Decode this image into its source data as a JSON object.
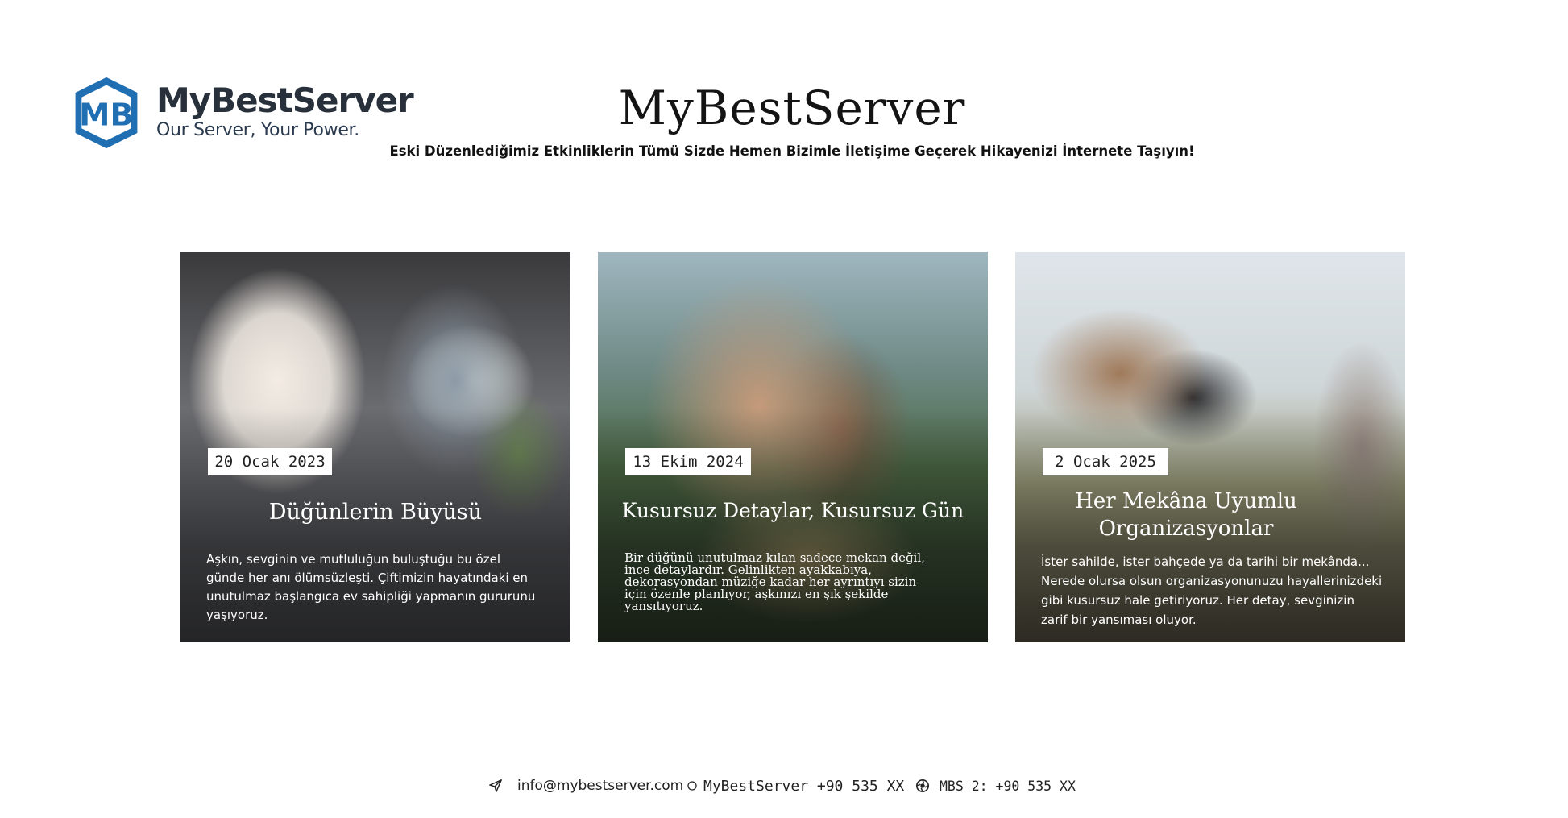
{
  "brand": {
    "logo_name": "MyBestServer",
    "logo_tagline": "Our Server, Your Power.",
    "logo_monogram": "MB",
    "brand_color": "#1f6fb2"
  },
  "header": {
    "title": "MyBestServer",
    "tagline": "Eski Düzenlediğimiz Etkinliklerin Tümü Sizde Hemen Bizimle İletişime Geçerek Hikayenizi İnternete Taşıyın!"
  },
  "cards": [
    {
      "date": "20 Ocak 2023",
      "title": "Düğünlerin Büyüsü",
      "description": "Aşkın, sevginin ve mutluluğun buluştuğu bu özel günde her anı ölümsüzleşti. Çiftimizin hayatındaki en unutulmaz başlangıca ev sahipliği yapmanın gururunu yaşıyoruz."
    },
    {
      "date": "13 Ekim 2024",
      "title": "Kusursuz Detaylar, Kusursuz Gün",
      "description": "Bir düğünü unutulmaz kılan sadece mekan değil, ince detaylardır. Gelinlikten ayakkabıya, dekorasyondan müziğe kadar her ayrıntıyı sizin için özenle planlıyor, aşkınızı en şık şekilde yansıtıyoruz."
    },
    {
      "date": "2 Ocak 2025",
      "title": "Her Mekâna Uyumlu Organizasyonlar",
      "description": "İster sahilde, ister bahçede ya da tarihi bir mekânda... Nerede olursa olsun organizasyonunuzu hayallerinizdeki gibi kusursuz hale getiriyoruz. Her detay, sevginizin zarif bir yansıması oluyor."
    }
  ],
  "footer": {
    "email": "info@mybestserver.com",
    "phone1": "MyBestServer +90 535  XX",
    "phone2": "MBS 2: +90 535 XX",
    "icons": [
      "send-icon",
      "phone-circle-icon",
      "aperture-icon"
    ]
  }
}
